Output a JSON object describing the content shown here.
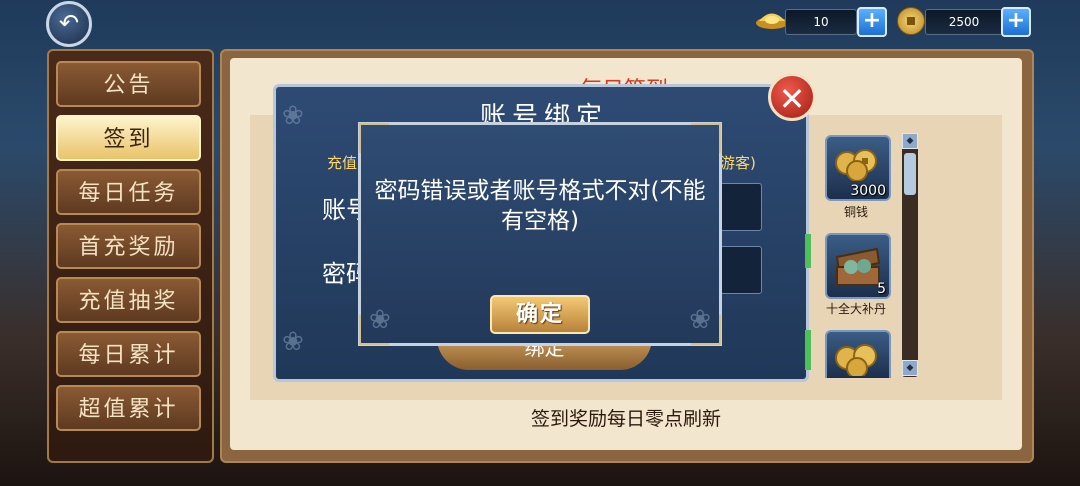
{
  "topbar": {
    "back_icon": "back-arrow-icon",
    "ingot": {
      "value": "10",
      "icon": "gold-ingot-icon"
    },
    "coins": {
      "value": "2500",
      "icon": "copper-coin-icon"
    },
    "plus_label": "+"
  },
  "sidebar": {
    "items": [
      {
        "label": "公告"
      },
      {
        "label": "签到",
        "active": true
      },
      {
        "label": "每日任务"
      },
      {
        "label": "首充奖励"
      },
      {
        "label": "充值抽奖"
      },
      {
        "label": "每日累计"
      },
      {
        "label": "超值累计"
      }
    ]
  },
  "main": {
    "title": "每日签到",
    "footer": "签到奖励每日零点刷新",
    "rewards": [
      {
        "count": "3000",
        "name": "铜钱",
        "icon": "copper-coins-icon"
      },
      {
        "count": "5",
        "name": "十全大补丹",
        "icon": "pill-chest-icon"
      },
      {
        "count": "",
        "name": "",
        "icon": "copper-coins-icon"
      }
    ]
  },
  "bind_dialog": {
    "title": "账号绑定",
    "subtitle_left": "充值",
    "subtitle_right": "游客)",
    "account_label": "账号",
    "password_label": "密码",
    "bind_button": "绑定",
    "close_icon": "close-x-icon"
  },
  "error_dialog": {
    "message": "密码错误或者账号格式不对(不能有空格)",
    "ok_label": "确定"
  },
  "colors": {
    "accent_gold": "#e8c36a",
    "title_red": "#d43b1e",
    "dialog_blue": "#2f4c73"
  }
}
